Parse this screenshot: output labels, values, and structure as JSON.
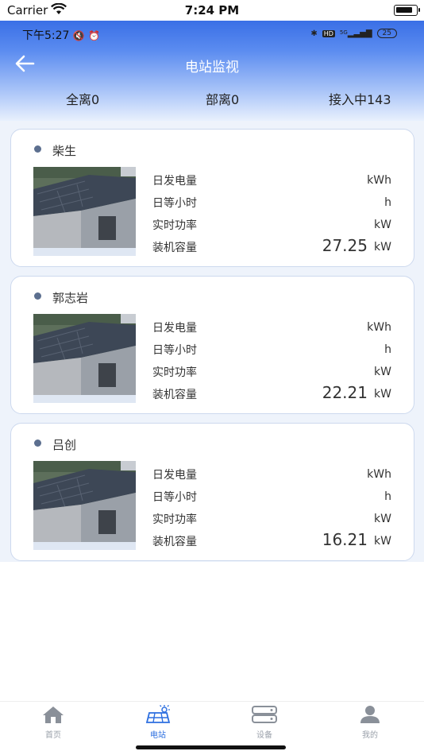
{
  "ios_status": {
    "carrier": "Carrier",
    "time": "7:24 PM"
  },
  "android_status": {
    "time_text": "下午5:27",
    "battery": "25",
    "network": "5G",
    "hd": "HD"
  },
  "header": {
    "title": "电站监视",
    "summary": {
      "all_offline": "全离0",
      "partial_offline": "部离0",
      "connecting": "接入中143"
    }
  },
  "stations": [
    {
      "name": "柴生",
      "rows": [
        {
          "label": "日发电量",
          "value": "",
          "unit": "kWh"
        },
        {
          "label": "日等小时",
          "value": "",
          "unit": "h"
        },
        {
          "label": "实时功率",
          "value": "",
          "unit": "kW"
        },
        {
          "label": "装机容量",
          "value": "27.25",
          "unit": "kW"
        }
      ]
    },
    {
      "name": "郭志岩",
      "rows": [
        {
          "label": "日发电量",
          "value": "",
          "unit": "kWh"
        },
        {
          "label": "日等小时",
          "value": "",
          "unit": "h"
        },
        {
          "label": "实时功率",
          "value": "",
          "unit": "kW"
        },
        {
          "label": "装机容量",
          "value": "22.21",
          "unit": "kW"
        }
      ]
    },
    {
      "name": "吕创",
      "rows": [
        {
          "label": "日发电量",
          "value": "",
          "unit": "kWh"
        },
        {
          "label": "日等小时",
          "value": "",
          "unit": "h"
        },
        {
          "label": "实时功率",
          "value": "",
          "unit": "kW"
        },
        {
          "label": "装机容量",
          "value": "16.21",
          "unit": "kW"
        }
      ]
    }
  ],
  "tabbar": {
    "items": [
      {
        "label": "首页",
        "icon": "home-icon"
      },
      {
        "label": "电站",
        "icon": "solar-panel-icon"
      },
      {
        "label": "设备",
        "icon": "device-icon"
      },
      {
        "label": "我的",
        "icon": "user-icon"
      }
    ],
    "active_index": 1
  },
  "colors": {
    "accent": "#2d6fe0",
    "header_top": "#3a6fe6",
    "inactive": "#9aa0aa"
  }
}
